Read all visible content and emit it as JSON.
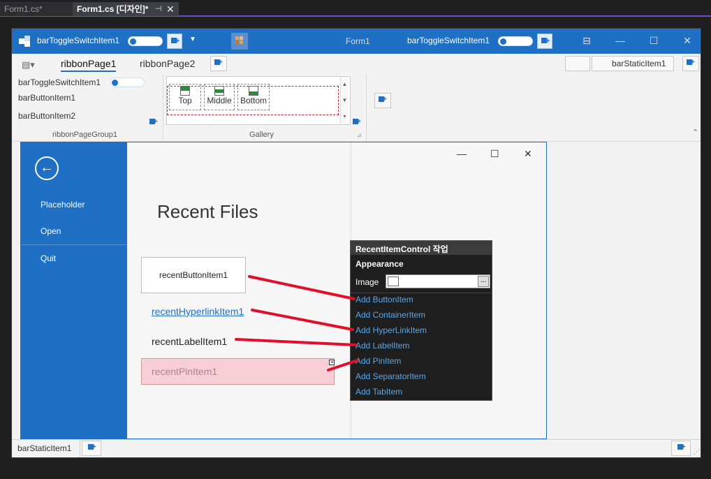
{
  "ide": {
    "tabs": [
      {
        "label": "Form1.cs*"
      },
      {
        "label": "Form1.cs [디자인]*"
      }
    ]
  },
  "titlebar": {
    "left_toggle_label": "barToggleSwitchItem1",
    "form_title": "Form1",
    "right_toggle_label": "barToggleSwitchItem1"
  },
  "ribbon": {
    "tabs": [
      "ribbonPage1",
      "ribbonPage2"
    ],
    "items": {
      "toggle": "barToggleSwitchItem1",
      "button1": "barButtonItem1",
      "button2": "barButtonItem2"
    },
    "group1_label": "ribbonPageGroup1",
    "gallery_label": "Gallery",
    "gallery_items": [
      "Top",
      "Middle",
      "Bottom"
    ],
    "static_item": "barStaticItem1"
  },
  "backstage": {
    "menu": [
      "Placeholder",
      "Open",
      "Quit"
    ],
    "recent_title": "Recent Files",
    "items": {
      "button": "recentButtonItem1",
      "hyperlink": "recentHyperlinkItem1",
      "label": "recentLabelItem1",
      "pin": "recentPinItem1"
    }
  },
  "smart_tag": {
    "title": "RecentItemControl 작업",
    "section": "Appearance",
    "image_label": "Image",
    "browse": "...",
    "actions": [
      "Add ButtonItem",
      "Add ContainerItem",
      "Add HyperLinkItem",
      "Add LabelItem",
      "Add PinItem",
      "Add SeparatorItem",
      "Add TabItem"
    ]
  },
  "statusbar": {
    "static_item": "barStaticItem1"
  },
  "colors": {
    "accent": "#1f6fc4",
    "annotation_red": "#e0102a",
    "pin_bg": "#f8cfd6",
    "link": "#5aa8e8"
  }
}
